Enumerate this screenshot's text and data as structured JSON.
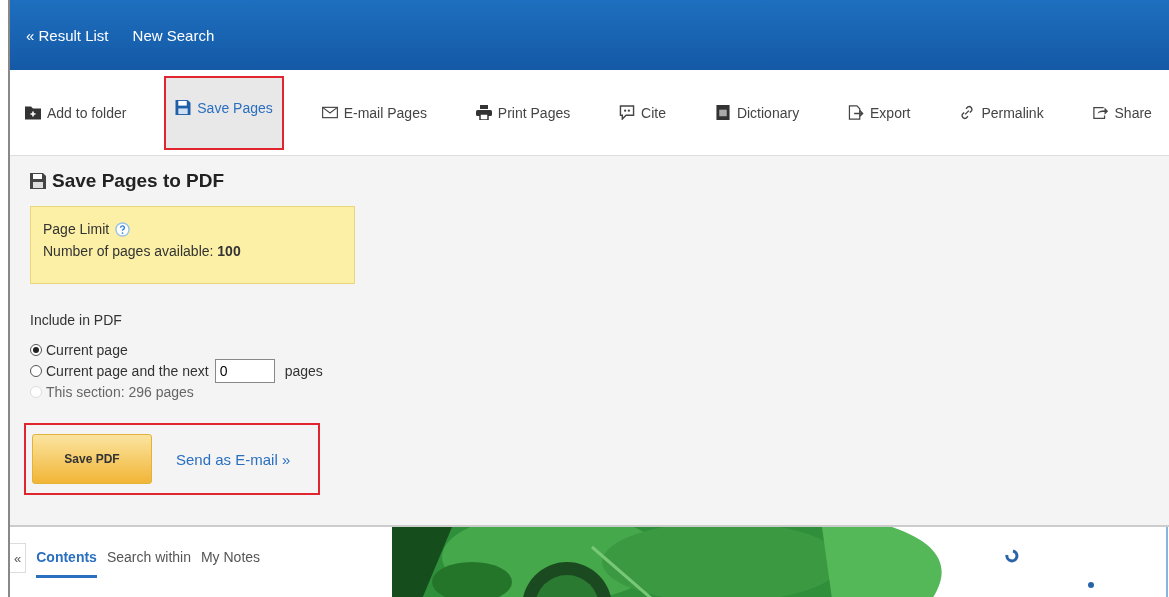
{
  "nav": [
    {
      "label": "« Result List"
    },
    {
      "label": "New Search"
    }
  ],
  "toolbar": [
    {
      "label": "Add to folder",
      "kind": "folder",
      "selected": false,
      "highlighted": false
    },
    {
      "label": "Save Pages",
      "kind": "save",
      "selected": true,
      "highlighted": true
    },
    {
      "label": "E-mail Pages",
      "kind": "mail",
      "selected": false,
      "highlighted": false
    },
    {
      "label": "Print Pages",
      "kind": "print",
      "selected": false,
      "highlighted": false
    },
    {
      "label": "Cite",
      "kind": "cite",
      "selected": false,
      "highlighted": false
    },
    {
      "label": "Dictionary",
      "kind": "dictionary",
      "selected": false,
      "highlighted": false
    },
    {
      "label": "Export",
      "kind": "export",
      "selected": false,
      "highlighted": false
    },
    {
      "label": "Permalink",
      "kind": "link",
      "selected": false,
      "highlighted": false
    },
    {
      "label": "Share",
      "kind": "share",
      "selected": false,
      "highlighted": false
    }
  ],
  "panel": {
    "title": "Save Pages to PDF",
    "limit": {
      "heading": "Page Limit",
      "text": "Number of pages available: **100**"
    },
    "include_label": "Include in PDF",
    "options": [
      {
        "label": "Current page",
        "selected": true,
        "disabled": false
      },
      {
        "label": "Current page and the next",
        "selected": false,
        "disabled": false,
        "value": "0",
        "suffix": "pages"
      },
      {
        "label": "This section: 296 pages",
        "selected": false,
        "disabled": true
      }
    ],
    "actions_highlighted": true,
    "save_button": "Save PDF",
    "email_link": "Send as E-mail »"
  },
  "bottom": {
    "collapse": "«",
    "tabs": [
      {
        "label": "Contents",
        "selected": true
      },
      {
        "label": "Search within",
        "selected": false
      },
      {
        "label": "My Notes",
        "selected": false
      }
    ]
  }
}
